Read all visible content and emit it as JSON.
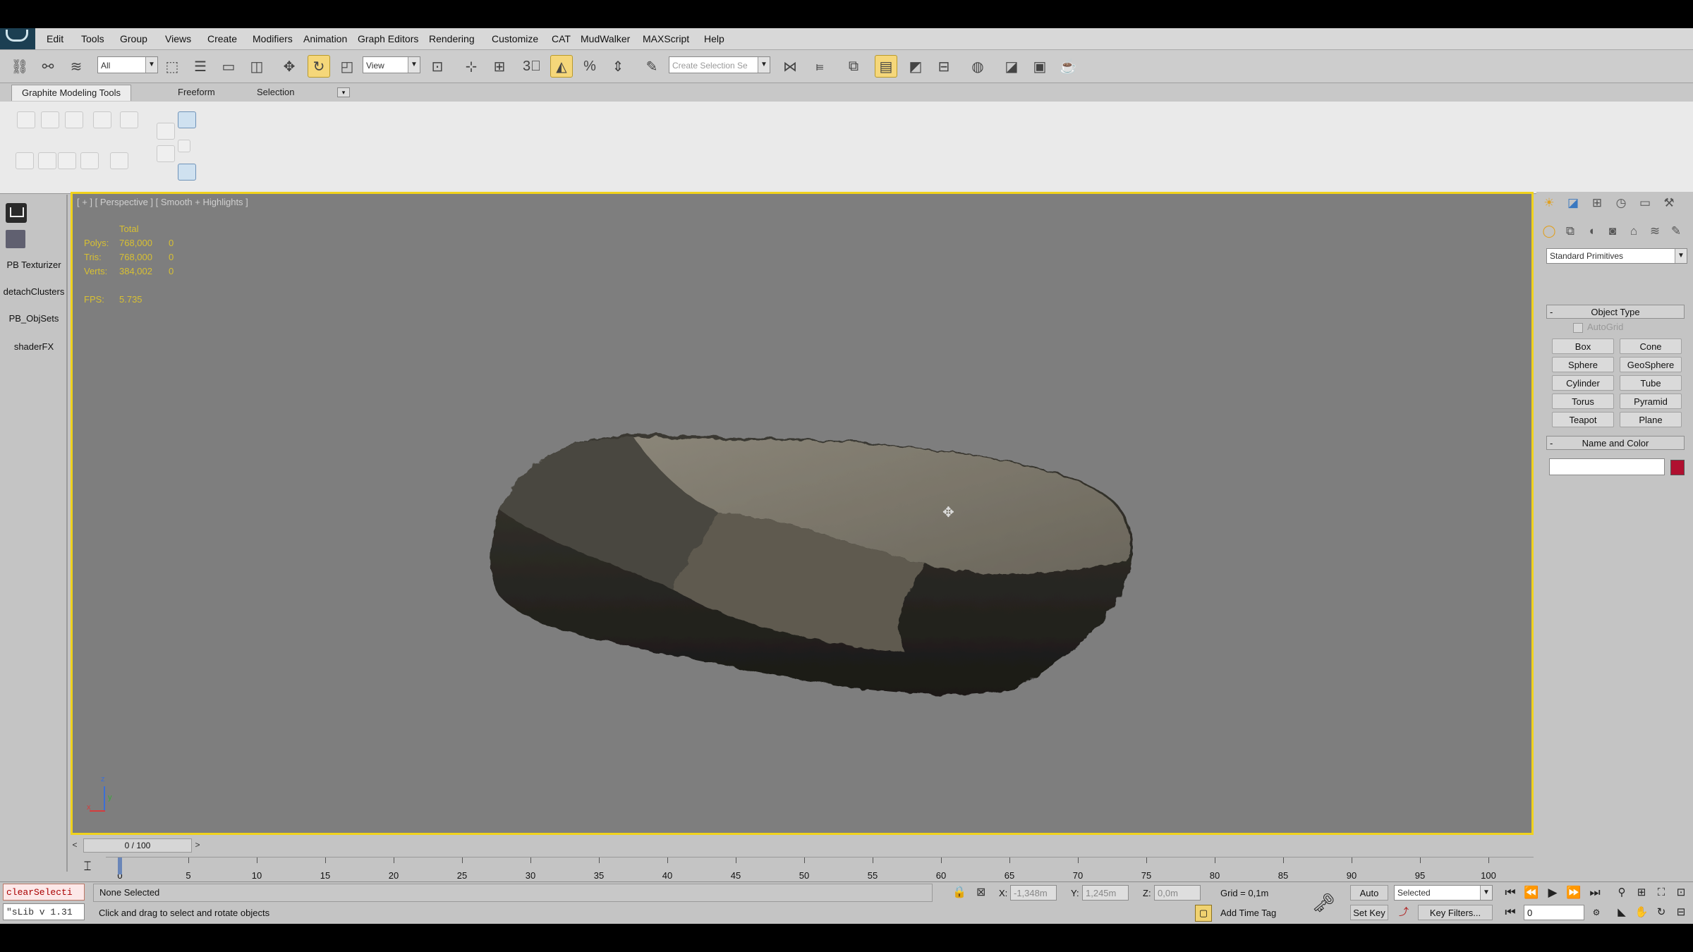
{
  "menu": [
    "Edit",
    "Tools",
    "Group",
    "Views",
    "Create",
    "Modifiers",
    "Animation",
    "Graph Editors",
    "Rendering",
    "Customize",
    "CAT",
    "MudWalker",
    "MAXScript",
    "Help"
  ],
  "toolbar": {
    "selection_filter": "All",
    "ref_coord": "View",
    "named_selection": "Create Selection Se"
  },
  "ribbon": {
    "tabs": [
      "Graphite Modeling Tools",
      "Freeform",
      "Selection"
    ]
  },
  "left_panel": {
    "items": [
      "PB Texturizer",
      "detachClusters",
      "PB_ObjSets",
      "shaderFX"
    ]
  },
  "viewport": {
    "label": "[ + ] [ Perspective ] [ Smooth + Highlights ]",
    "stats": {
      "header": "Total",
      "rows": [
        {
          "label": "Polys:",
          "value": "768,000",
          "sel": "0"
        },
        {
          "label": "Tris:",
          "value": "768,000",
          "sel": "0"
        },
        {
          "label": "Verts:",
          "value": "384,002",
          "sel": "0"
        }
      ],
      "fps_label": "FPS:",
      "fps": "5.735"
    },
    "axis": {
      "z": "z",
      "x": "x",
      "y": "y"
    }
  },
  "command_panel": {
    "category": "Standard Primitives",
    "object_type_title": "Object Type",
    "autogrid": "AutoGrid",
    "buttons": [
      "Box",
      "Cone",
      "Sphere",
      "GeoSphere",
      "Cylinder",
      "Tube",
      "Torus",
      "Pyramid",
      "Teapot",
      "Plane"
    ],
    "name_color_title": "Name and Color",
    "object_name": "",
    "color": "#b01030"
  },
  "timeline": {
    "frame": "0 / 100",
    "ticks": [
      "0",
      "5",
      "10",
      "15",
      "20",
      "25",
      "30",
      "35",
      "40",
      "45",
      "50",
      "55",
      "60",
      "65",
      "70",
      "75",
      "80",
      "85",
      "90",
      "95",
      "100"
    ]
  },
  "status": {
    "script_line1": "clearSelecti",
    "script_line2": "\"sLib v 1.31",
    "selection": "None Selected",
    "prompt": "Click and drag to select and rotate objects",
    "x_label": "X:",
    "x": "-1,348m",
    "y_label": "Y:",
    "y": "1,245m",
    "z_label": "Z:",
    "z": "0,0m",
    "grid": "Grid = 0,1m",
    "add_time_tag": "Add Time Tag",
    "auto_key": "Auto Key",
    "set_key": "Set Key",
    "key_mode": "Selected",
    "key_filters": "Key Filters...",
    "current_frame": "0"
  }
}
